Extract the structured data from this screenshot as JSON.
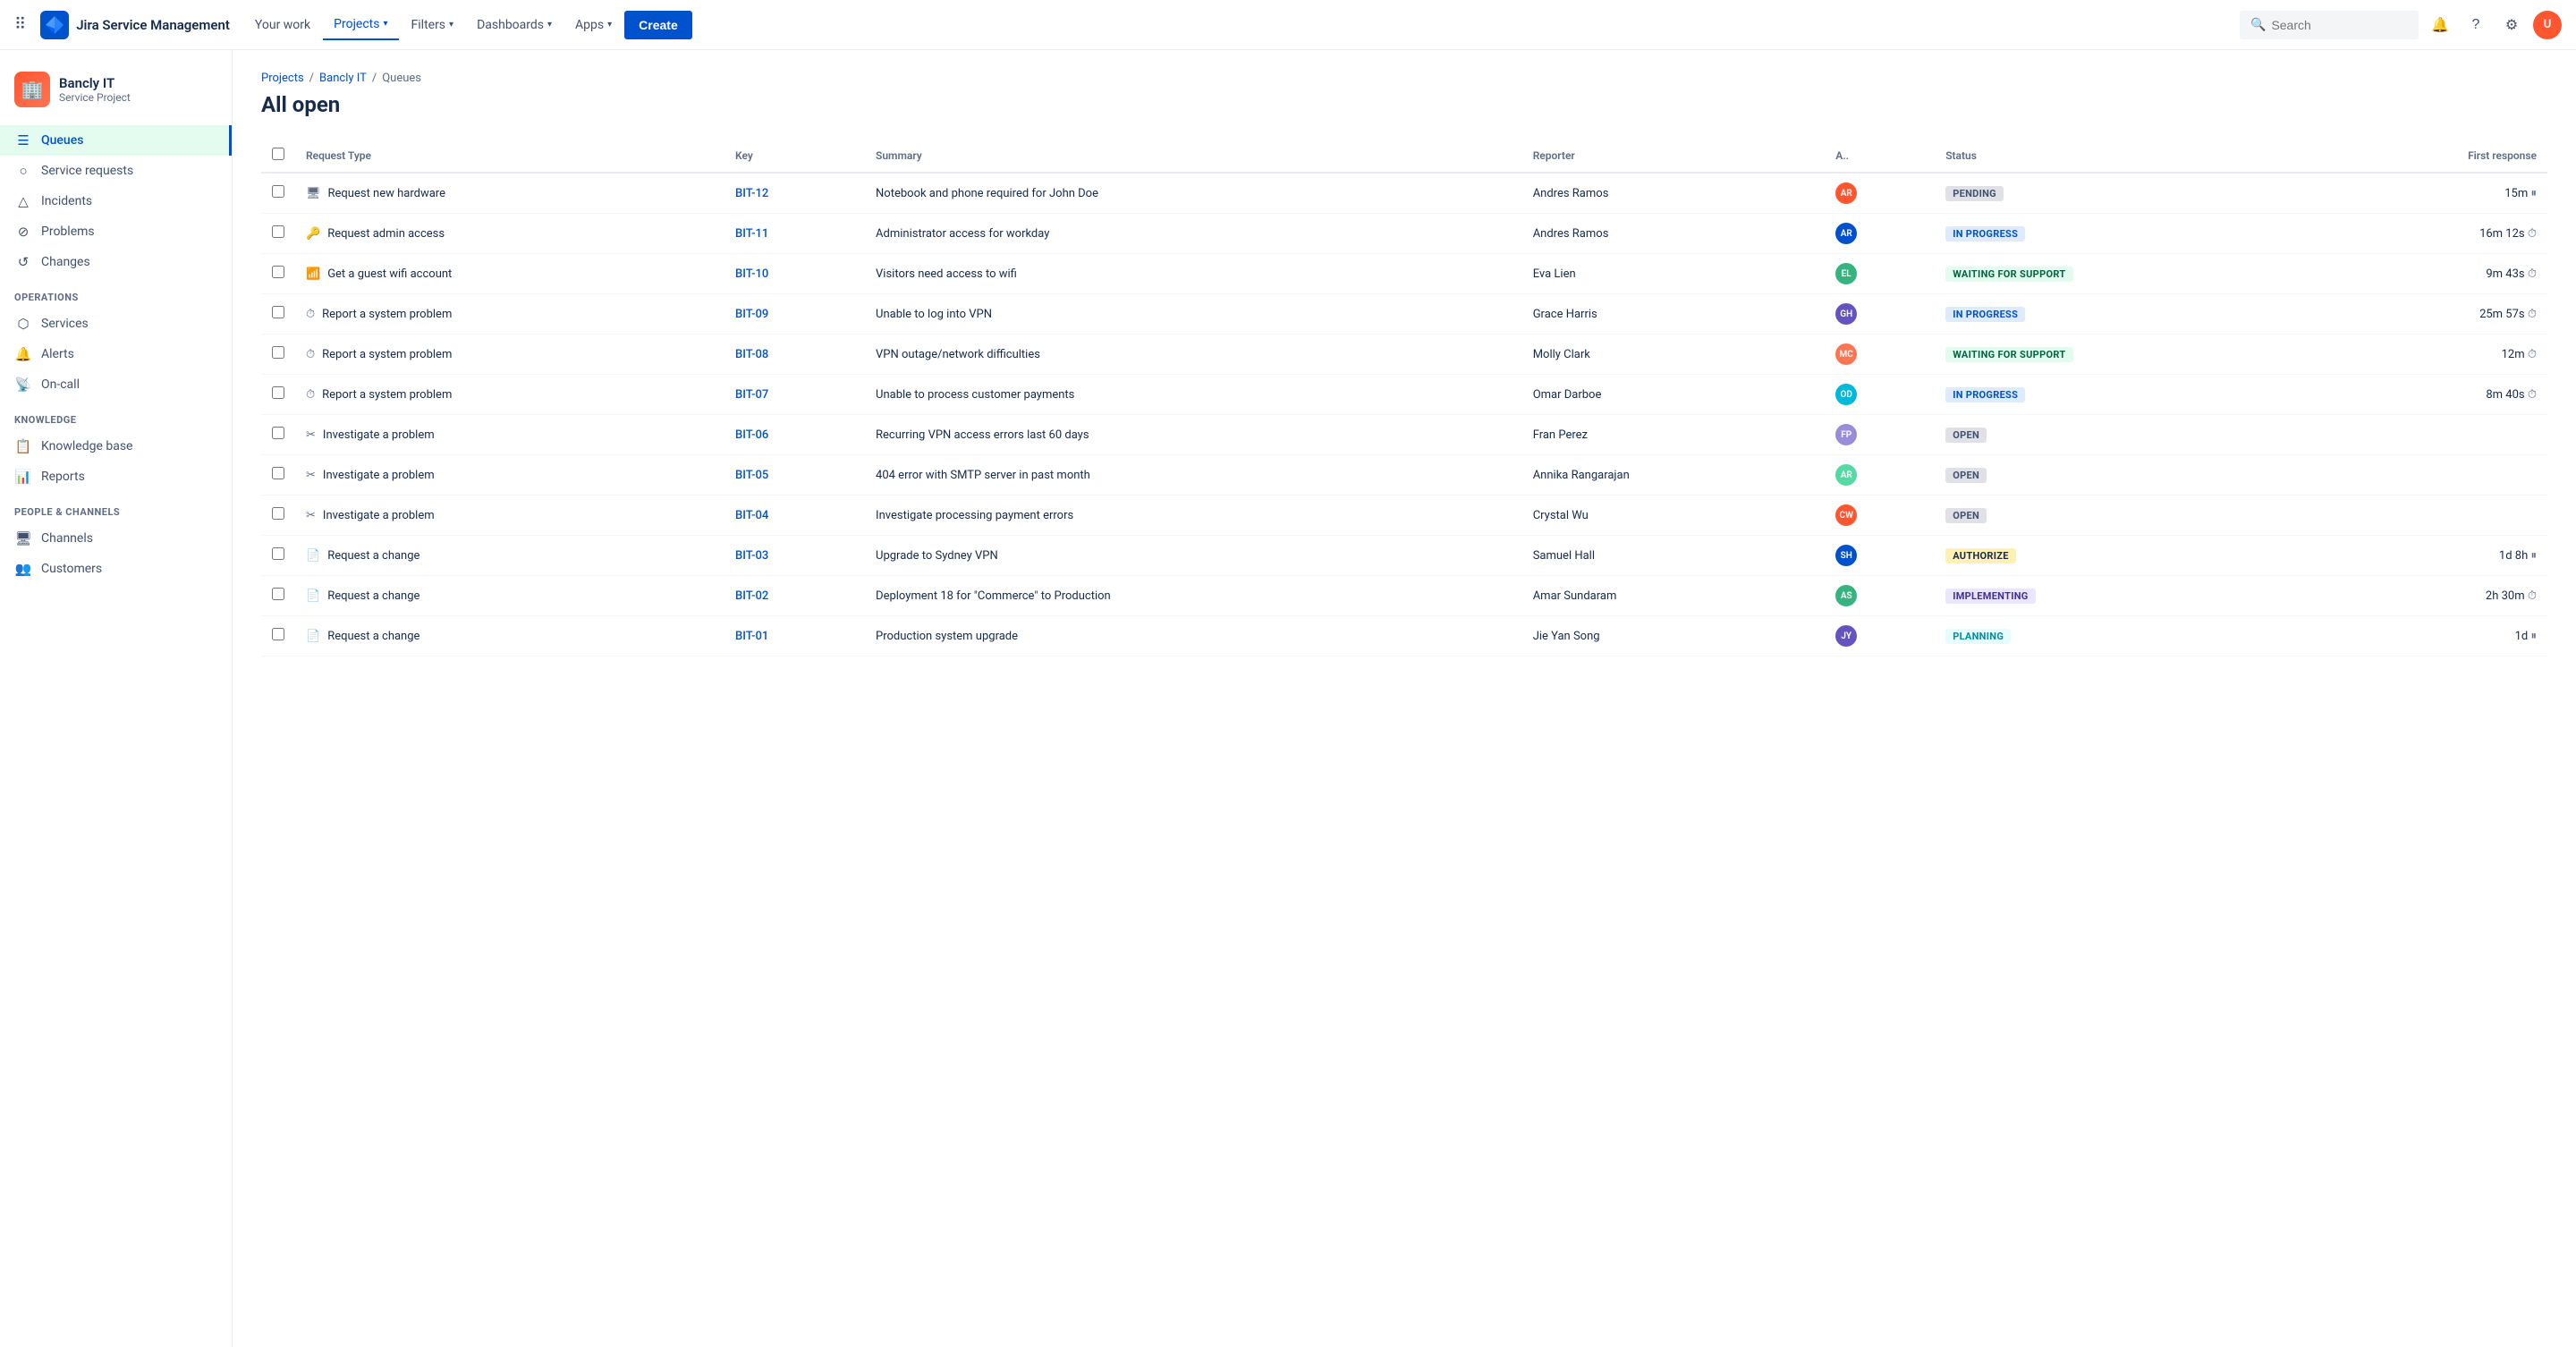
{
  "topnav": {
    "app_name": "Jira Service Management",
    "nav_items": [
      {
        "label": "Your work",
        "active": false
      },
      {
        "label": "Projects",
        "active": true,
        "has_dropdown": true
      },
      {
        "label": "Filters",
        "active": false,
        "has_dropdown": true
      },
      {
        "label": "Dashboards",
        "active": false,
        "has_dropdown": true
      },
      {
        "label": "Apps",
        "active": false,
        "has_dropdown": true
      }
    ],
    "create_label": "Create",
    "search_placeholder": "Search"
  },
  "sidebar": {
    "project_name": "Bancly IT",
    "project_type": "Service Project",
    "items": [
      {
        "label": "Queues",
        "active": true,
        "icon": "☰"
      },
      {
        "label": "Service requests",
        "active": false,
        "icon": "○"
      },
      {
        "label": "Incidents",
        "active": false,
        "icon": "△"
      },
      {
        "label": "Problems",
        "active": false,
        "icon": "⊘"
      },
      {
        "label": "Changes",
        "active": false,
        "icon": "↺"
      }
    ],
    "operations_label": "OPERATIONS",
    "operations_items": [
      {
        "label": "Services",
        "active": false,
        "icon": "⬡"
      },
      {
        "label": "Alerts",
        "active": false,
        "icon": "🔔"
      },
      {
        "label": "On-call",
        "active": false,
        "icon": "📡"
      }
    ],
    "knowledge_label": "KNOWLEDGE",
    "knowledge_items": [
      {
        "label": "Knowledge base",
        "active": false,
        "icon": "📋"
      },
      {
        "label": "Reports",
        "active": false,
        "icon": "📊"
      }
    ],
    "people_label": "PEOPLE & CHANNELS",
    "people_items": [
      {
        "label": "Channels",
        "active": false,
        "icon": "🖥"
      },
      {
        "label": "Customers",
        "active": false,
        "icon": "👥"
      }
    ]
  },
  "breadcrumb": {
    "items": [
      "Projects",
      "Bancly IT",
      "Queues"
    ]
  },
  "page_title": "All open",
  "table": {
    "columns": [
      "Request Type",
      "Key",
      "Summary",
      "Reporter",
      "A..",
      "Status",
      "First response"
    ],
    "rows": [
      {
        "type": "Request new hardware",
        "type_icon": "🖥",
        "key": "BIT-12",
        "summary": "Notebook and phone required for John Doe",
        "reporter": "Andres Ramos",
        "assignee_color": "#FF5630",
        "assignee_initials": "AR",
        "status": "PENDING",
        "status_class": "status-pending",
        "first_response": "15m",
        "response_icon": "pause"
      },
      {
        "type": "Request admin access",
        "type_icon": "🔑",
        "key": "BIT-11",
        "summary": "Administrator access for workday",
        "reporter": "Andres Ramos",
        "assignee_color": "#FF5630",
        "assignee_initials": "AR",
        "status": "IN PROGRESS",
        "status_class": "status-in-progress",
        "first_response": "16m 12s",
        "response_icon": "timer"
      },
      {
        "type": "Get a guest wifi account",
        "type_icon": "📶",
        "key": "BIT-10",
        "summary": "Visitors need access to wifi",
        "reporter": "Eva Lien",
        "assignee_color": "#36B37E",
        "assignee_initials": "EL",
        "status": "WAITING FOR SUPPORT",
        "status_class": "status-waiting",
        "first_response": "9m 43s",
        "response_icon": "timer"
      },
      {
        "type": "Report a system problem",
        "type_icon": "⏱",
        "key": "BIT-09",
        "summary": "Unable to log into VPN",
        "reporter": "Grace Harris",
        "assignee_color": "#6554C0",
        "assignee_initials": "GH",
        "status": "IN PROGRESS",
        "status_class": "status-in-progress",
        "first_response": "25m 57s",
        "response_icon": "timer"
      },
      {
        "type": "Report a system problem",
        "type_icon": "⏱",
        "key": "BIT-08",
        "summary": "VPN outage/network difficulties",
        "reporter": "Molly Clark",
        "assignee_color": "#FF7452",
        "assignee_initials": "MC",
        "status": "WAITING FOR SUPPORT",
        "status_class": "status-waiting",
        "first_response": "12m",
        "response_icon": "timer"
      },
      {
        "type": "Report a system problem",
        "type_icon": "⏱",
        "key": "BIT-07",
        "summary": "Unable to process customer payments",
        "reporter": "Omar Darboe",
        "assignee_color": "#0052CC",
        "assignee_initials": "OD",
        "status": "IN PROGRESS",
        "status_class": "status-in-progress",
        "first_response": "8m 40s",
        "response_icon": "timer"
      },
      {
        "type": "Investigate a problem",
        "type_icon": "✂",
        "key": "BIT-06",
        "summary": "Recurring VPN access errors last 60 days",
        "reporter": "Fran Perez",
        "assignee_color": "#FF5630",
        "assignee_initials": "FP",
        "status": "OPEN",
        "status_class": "status-open",
        "first_response": "",
        "response_icon": ""
      },
      {
        "type": "Investigate a problem",
        "type_icon": "✂",
        "key": "BIT-05",
        "summary": "404 error with SMTP server in past month",
        "reporter": "Annika Rangarajan",
        "assignee_color": "#36B37E",
        "assignee_initials": "AR",
        "status": "OPEN",
        "status_class": "status-open",
        "first_response": "",
        "response_icon": ""
      },
      {
        "type": "Investigate a problem",
        "type_icon": "✂",
        "key": "BIT-04",
        "summary": "Investigate processing payment errors",
        "reporter": "Crystal Wu",
        "assignee_color": "#6554C0",
        "assignee_initials": "CW",
        "status": "OPEN",
        "status_class": "status-open",
        "first_response": "",
        "response_icon": ""
      },
      {
        "type": "Request a change",
        "type_icon": "📄",
        "key": "BIT-03",
        "summary": "Upgrade to Sydney VPN",
        "reporter": "Samuel Hall",
        "assignee_color": "#FF5630",
        "assignee_initials": "SH",
        "status": "AUTHORIZE",
        "status_class": "status-authorize",
        "first_response": "1d 8h",
        "response_icon": "pause"
      },
      {
        "type": "Request a change",
        "type_icon": "📄",
        "key": "BIT-02",
        "summary": "Deployment 18 for \"Commerce\" to Production",
        "reporter": "Amar Sundaram",
        "assignee_color": "#0052CC",
        "assignee_initials": "AS",
        "status": "IMPLEMENTING",
        "status_class": "status-implementing",
        "first_response": "2h 30m",
        "response_icon": "timer"
      },
      {
        "type": "Request a change",
        "type_icon": "📄",
        "key": "BIT-01",
        "summary": "Production system upgrade",
        "reporter": "Jie Yan Song",
        "assignee_color": "#36B37E",
        "assignee_initials": "JY",
        "status": "PLANNING",
        "status_class": "status-planning",
        "first_response": "1d",
        "response_icon": "pause"
      }
    ]
  }
}
